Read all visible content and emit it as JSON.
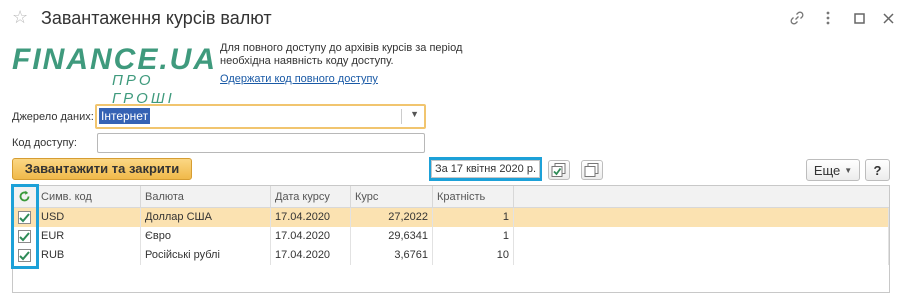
{
  "window": {
    "title": "Завантаження курсів валют",
    "icons": [
      "star-icon",
      "link-icon",
      "more-vertical-icon",
      "maximize-icon",
      "close-icon"
    ]
  },
  "logo": {
    "main": "FINANCE.UA",
    "sub": "ПРО ГРОШІ"
  },
  "info": {
    "text": "Для повного доступу до архівів курсів за період необхідна наявність коду доступу.",
    "link": "Одержати код повного доступу"
  },
  "form": {
    "source_label": "Джерело даних:",
    "source_value": "Інтернет",
    "code_label": "Код доступу:",
    "code_value": ""
  },
  "toolbar": {
    "load_close": "Завантажити та закрити",
    "date_button": "За 17 квітня 2020 р.",
    "more": "Еще",
    "help": "?"
  },
  "table": {
    "columns": [
      "Симв. код",
      "Валюта",
      "Дата курсу",
      "Курс",
      "Кратність"
    ],
    "rows": [
      {
        "checked": true,
        "code": "USD",
        "currency": "Доллар США",
        "date": "17.04.2020",
        "rate": "27,2022",
        "multiplicity": "1"
      },
      {
        "checked": true,
        "code": "EUR",
        "currency": "Євро",
        "date": "17.04.2020",
        "rate": "29,6341",
        "multiplicity": "1"
      },
      {
        "checked": true,
        "code": "RUB",
        "currency": "Російські рублі",
        "date": "17.04.2020",
        "rate": "3,6761",
        "multiplicity": "10"
      }
    ]
  },
  "colors": {
    "accent_highlight": "#1da1d8",
    "primary_button": "#f0b94a",
    "selected_row": "#fbe2b1",
    "logo": "#3f9a7d",
    "link": "#1a5aa6",
    "check": "#2e8b57"
  }
}
